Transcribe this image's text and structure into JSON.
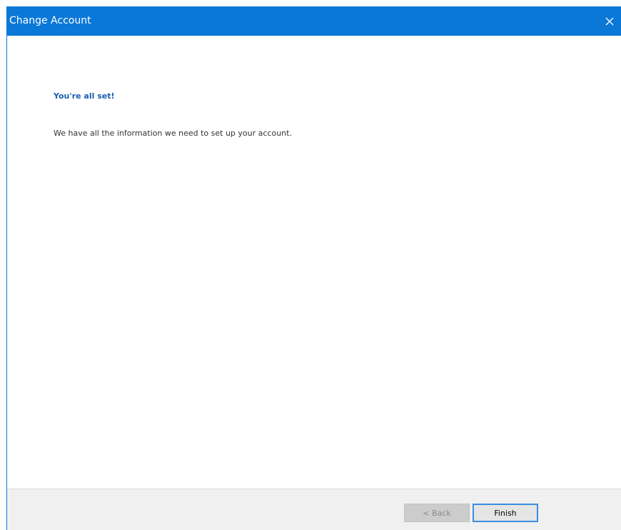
{
  "window": {
    "title": "Change Account",
    "close_icon": "close-icon"
  },
  "content": {
    "heading": "You're all set!",
    "message": "We have all the information we need to set up your account."
  },
  "footer": {
    "back_label": "< Back",
    "finish_label": "Finish"
  },
  "colors": {
    "titlebar": "#0a78d7",
    "heading": "#1a5db5",
    "footer_bg": "#f0f0f0",
    "focus_border": "#3c8ede"
  }
}
